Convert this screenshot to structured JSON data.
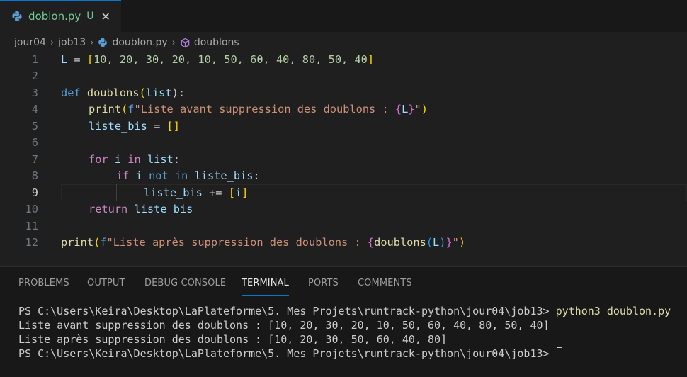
{
  "tab": {
    "filename": "doblon.py",
    "status": "U",
    "close": "✕"
  },
  "breadcrumb": {
    "items": [
      "jour04",
      "job13",
      "doublon.py",
      "doublons"
    ],
    "separator": "›"
  },
  "editor": {
    "current_line": 9,
    "lines": [
      {
        "n": "1"
      },
      {
        "n": "2"
      },
      {
        "n": "3"
      },
      {
        "n": "4"
      },
      {
        "n": "5"
      },
      {
        "n": "6"
      },
      {
        "n": "7"
      },
      {
        "n": "8"
      },
      {
        "n": "9"
      },
      {
        "n": "10"
      },
      {
        "n": "11"
      },
      {
        "n": "12"
      }
    ],
    "tokens": {
      "l1": [
        "L",
        " = ",
        "[",
        "10, 20, 30, 20, 10, 50, 60, 40, 80, 50, 40",
        "]"
      ],
      "l3": [
        "def",
        " ",
        "doublons",
        "(",
        "list",
        "):"
      ],
      "l4": [
        "print",
        "(",
        "f",
        "\"Liste avant suppression des doublons : ",
        "{",
        "L",
        "}",
        "\"",
        ")"
      ],
      "l5": [
        "liste_bis",
        " = ",
        "[]"
      ],
      "l7": [
        "for",
        " ",
        "i",
        " ",
        "in",
        " ",
        "list",
        ":"
      ],
      "l8": [
        "if",
        " ",
        "i",
        " ",
        "not",
        " ",
        "in",
        " ",
        "liste_bis",
        ":"
      ],
      "l9": [
        "liste_bis",
        " += ",
        "[",
        "i",
        "]"
      ],
      "l10": [
        "return",
        " ",
        "liste_bis"
      ],
      "l12": [
        "print",
        "(",
        "f",
        "\"Liste après suppression des doublons : ",
        "{",
        "doublons",
        "(",
        "L",
        ")",
        "}",
        "\"",
        ")"
      ]
    }
  },
  "panel": {
    "tabs": [
      "PROBLEMS",
      "OUTPUT",
      "DEBUG CONSOLE",
      "TERMINAL",
      "PORTS",
      "COMMENTS"
    ],
    "active_tab": "TERMINAL"
  },
  "terminal": {
    "prompt": "PS C:\\Users\\Keira\\Desktop\\LaPlateforme\\5. Mes Projets\\runtrack-python\\jour04\\job13> ",
    "command": "python3 doublon.py",
    "output1": "Liste avant suppression des doublons : [10, 20, 30, 20, 10, 50, 60, 40, 80, 50, 40]",
    "output2": "Liste après suppression des doublons : [10, 20, 30, 50, 60, 40, 80]",
    "prompt2": "PS C:\\Users\\Keira\\Desktop\\LaPlateforme\\5. Mes Projets\\runtrack-python\\jour04\\job13> "
  },
  "colors": {
    "accent": "#0078d4",
    "untracked": "#73c991",
    "keyword": "#569cd6",
    "control": "#c586c0",
    "function": "#dcdcaa",
    "variable": "#9cdcfe",
    "number": "#b5cea8",
    "string": "#ce9178"
  },
  "icons": [
    "python-icon",
    "close-icon",
    "chevron-right-icon",
    "symbol-method-icon"
  ]
}
